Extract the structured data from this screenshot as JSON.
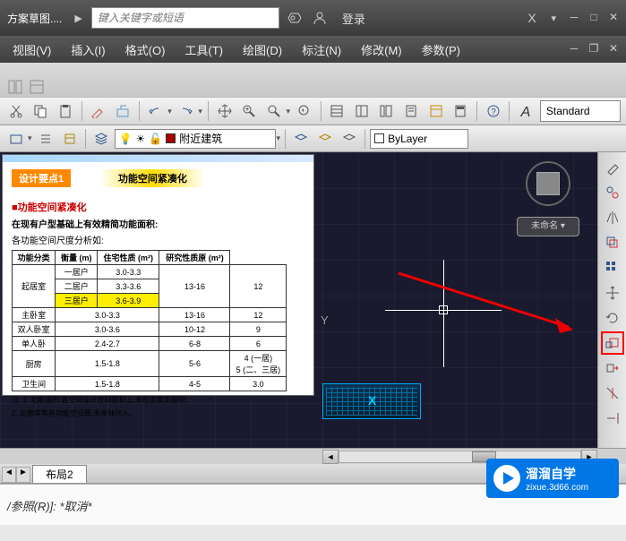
{
  "titlebar": {
    "doc_title": "方案草图....",
    "search_placeholder": "键入关键字或短语",
    "login": "登录"
  },
  "menus": [
    "视图(V)",
    "插入(I)",
    "格式(O)",
    "工具(T)",
    "绘图(D)",
    "标注(N)",
    "修改(M)",
    "参数(P)"
  ],
  "toolbar1": {
    "style_label": "Standard"
  },
  "toolbar2": {
    "layer_name": "附近建筑",
    "bylayer": "ByLayer"
  },
  "viewport": {
    "nav_label": "未命名 ▾",
    "ucs_y": "Y"
  },
  "doc": {
    "badge1": "设计要点1",
    "badge2": "功能空间紧凑化",
    "heading": "■功能空间紧凑化",
    "sub": "在现有户型基础上有效精简功能面积:",
    "sub2": "各功能空间尺度分析如:",
    "table": {
      "headers": [
        "功能分类",
        "衡量 (m)",
        "住宅性质 (m²)",
        "研究性质原 (m²)"
      ],
      "rows": [
        [
          "起居室",
          [
            "一居户",
            "二居户",
            "三居户"
          ],
          [
            "3.0-3.3",
            "3.3-3.6",
            "3.6-3.9"
          ],
          "13-16",
          "12"
        ],
        [
          "主卧室",
          "3.0-3.3",
          "",
          "13-16",
          "12"
        ],
        [
          "双人卧室",
          "3.0-3.6",
          "",
          "10-12",
          "9"
        ],
        [
          "单人卧",
          "2.4-2.7",
          "",
          "6-8",
          "6"
        ],
        [
          "厨房",
          "1.5-1.8",
          "",
          "5-6",
          "4 (一居)\n5 (二、三居)"
        ],
        [
          "卫生间",
          "1.5-1.8",
          "",
          "4-5",
          "3.0"
        ]
      ]
    },
    "note1": "注: 1. 功能面积:各空间设计控制面积上,未包含其余面积;",
    "note2": "2. 走廊等等各功能空间算,未单独列入。"
  },
  "tabs": {
    "layout": "布局2"
  },
  "command": {
    "text": "/参照(R)]: *取消*"
  },
  "watermark": {
    "title": "溜溜自学",
    "url": "zixue.3d66.com"
  },
  "icons": {
    "cut": "cut-icon",
    "copy": "copy-icon",
    "paste": "paste-icon",
    "undo": "undo-icon",
    "redo": "redo-icon",
    "pan": "pan-icon",
    "zoom": "zoom-icon"
  }
}
